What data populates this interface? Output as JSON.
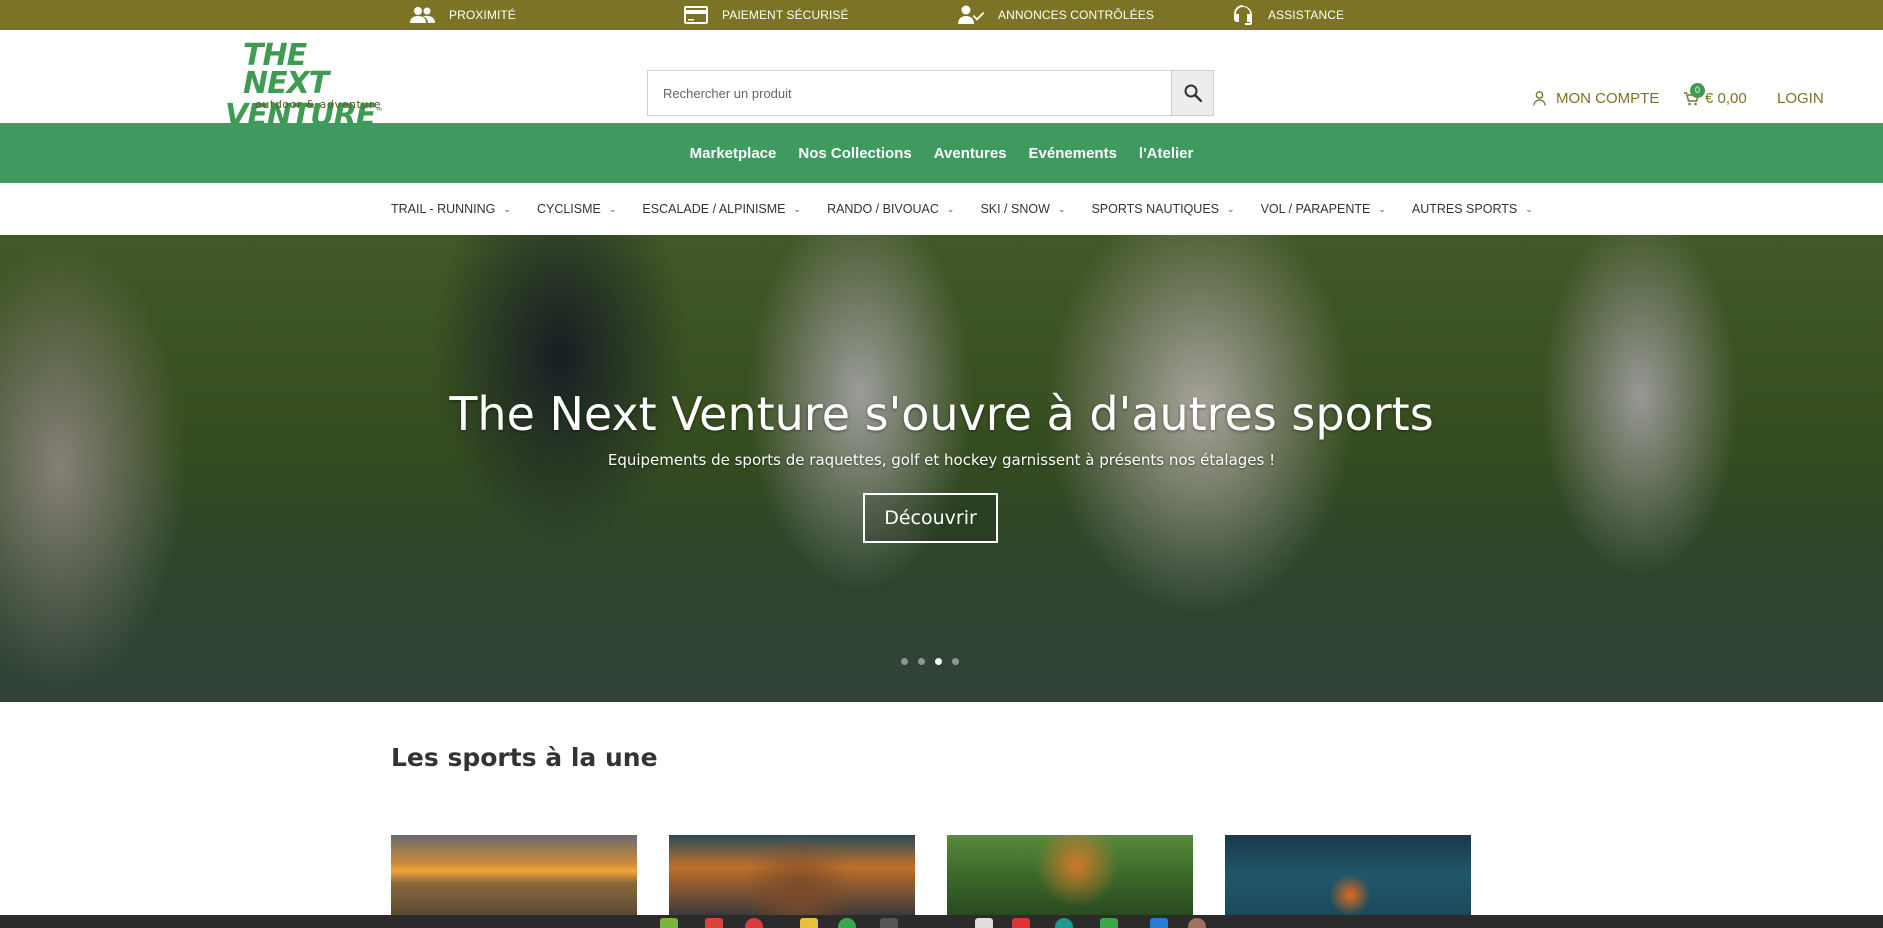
{
  "topbar": {
    "items": [
      {
        "label": "PROXIMITÉ",
        "icon": "users-icon"
      },
      {
        "label": "PAIEMENT SÉCURISÉ",
        "icon": "credit-card-icon"
      },
      {
        "label": "ANNONCES CONTRÔLÉES",
        "icon": "user-check-icon"
      },
      {
        "label": "ASSISTANCE",
        "icon": "headset-icon"
      }
    ]
  },
  "header": {
    "logo": {
      "line1": "THE NEXT",
      "line2": "VENTURE",
      "tm": "™",
      "tagline": "outdoor & adventure"
    },
    "search": {
      "placeholder": "Rechercher un produit",
      "button_icon": "search-icon"
    },
    "account_label": "MON COMPTE",
    "cart": {
      "count": "0",
      "total": "€ 0,00"
    },
    "login_label": "LOGIN"
  },
  "main_nav": {
    "items": [
      "Marketplace",
      "Nos Collections",
      "Aventures",
      "Evénements",
      "l'Atelier"
    ]
  },
  "category_nav": {
    "items": [
      "TRAIL - RUNNING",
      "CYCLISME",
      "ESCALADE / ALPINISME",
      "RANDO / BIVOUAC",
      "SKI / SNOW",
      "SPORTS NAUTIQUES",
      "VOL / PARAPENTE",
      "AUTRES SPORTS"
    ]
  },
  "hero": {
    "title": "The Next Venture s'ouvre à d'autres sports",
    "subtitle": "Equipements de sports de raquettes, golf et hockey garnissent à présents nos étalages !",
    "button_label": "Découvrir",
    "slides_count": 4,
    "active_slide": 3
  },
  "featured": {
    "title": "Les sports à la une"
  },
  "colors": {
    "topbar": "#7d7324",
    "green_nav": "#3f9a5f",
    "accent_olive": "#7d7324"
  }
}
